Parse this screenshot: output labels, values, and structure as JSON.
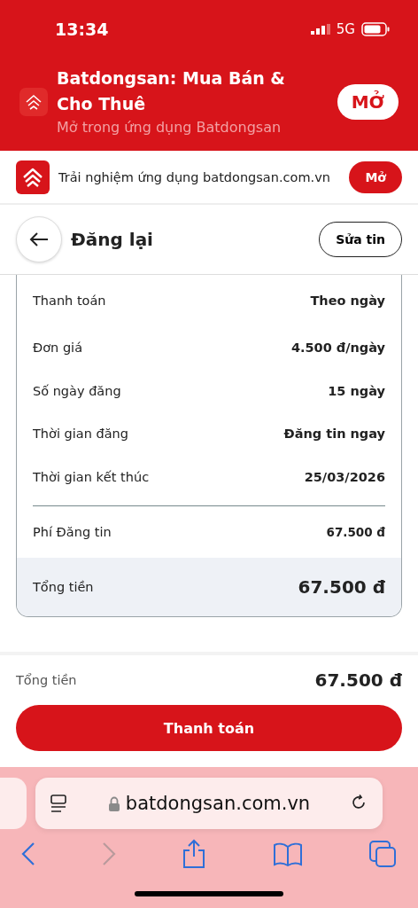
{
  "status_bar": {
    "time": "13:34",
    "network": "5G"
  },
  "smart_banner": {
    "title": "Batdongsan: Mua Bán & Cho Thuê",
    "subtitle": "Mở trong ứng dụng Batdongsan",
    "button": "MỞ"
  },
  "app_banner": {
    "text": "Trải nghiệm ứng dụng batdongsan.com.vn",
    "button": "Mở"
  },
  "header": {
    "title": "Đăng lại",
    "button": "Sửa tin"
  },
  "details": [
    {
      "label": "Thanh toán",
      "value": "Theo ngày"
    },
    {
      "label": "Đơn giá",
      "value": "4.500 đ/ngày"
    },
    {
      "label": "Số ngày đăng",
      "value": "15 ngày"
    },
    {
      "label": "Thời gian đăng",
      "value": "Đăng tin ngay"
    },
    {
      "label": "Thời gian kết thúc",
      "value": "25/03/2026"
    }
  ],
  "fees": [
    {
      "label": "Phí Đăng tin",
      "value": "67.500 đ"
    }
  ],
  "card_total": {
    "label": "Tổng tiền",
    "value": "67.500 đ"
  },
  "summary": {
    "label": "Tổng tiền",
    "value": "67.500 đ",
    "button": "Thanh toán"
  },
  "browser": {
    "url": "batdongsan.com.vn"
  }
}
